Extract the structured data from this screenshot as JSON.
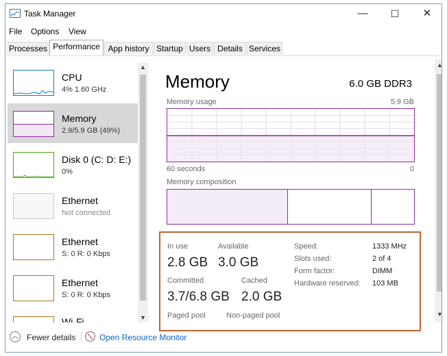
{
  "window": {
    "title": "Task Manager",
    "min": "—",
    "max": "☐",
    "close": "✕"
  },
  "menu": [
    "File",
    "Options",
    "View"
  ],
  "tabs": [
    "Processes",
    "Performance",
    "App history",
    "Startup",
    "Users",
    "Details",
    "Services"
  ],
  "active_tab": "Performance",
  "sidebar": {
    "items": [
      {
        "name": "CPU",
        "sub": "4% 1.60 GHz",
        "icon": "cpu-graph"
      },
      {
        "name": "Memory",
        "sub": "2.9/5.9 GB (49%)",
        "icon": "memory-graph"
      },
      {
        "name": "Disk 0 (C: D: E:)",
        "sub": "0%",
        "icon": "disk-graph"
      },
      {
        "name": "Ethernet",
        "sub": "Not connected",
        "icon": "ethernet-graph"
      },
      {
        "name": "Ethernet",
        "sub": "S: 0 R: 0 Kbps",
        "icon": "ethernet-graph"
      },
      {
        "name": "Ethernet",
        "sub": "S: 0 R: 0 Kbps",
        "icon": "ethernet-graph"
      },
      {
        "name": "Wi-Fi",
        "sub": "",
        "icon": "wifi-graph"
      }
    ],
    "selected_index": 1
  },
  "detail": {
    "title": "Memory",
    "spec": "6.0 GB DDR3",
    "usage_label": "Memory usage",
    "usage_max": "5.9 GB",
    "time_left": "60 seconds",
    "time_right": "0",
    "composition_label": "Memory composition",
    "usage_fraction": 0.49
  },
  "stats": {
    "in_use_label": "In use",
    "in_use": "2.8 GB",
    "available_label": "Available",
    "available": "3.0 GB",
    "committed_label": "Committed",
    "committed": "3.7/6.8 GB",
    "cached_label": "Cached",
    "cached": "2.0 GB",
    "paged_label": "Paged pool",
    "nonpaged_label": "Non-paged pool",
    "speed_label": "Speed:",
    "speed": "1333 MHz",
    "slots_label": "Slots used:",
    "slots": "2 of 4",
    "form_label": "Form factor:",
    "form": "DIMM",
    "reserved_label": "Hardware reserved:",
    "reserved": "103 MB"
  },
  "footer": {
    "fewer": "Fewer details",
    "monitor": "Open Resource Monitor"
  },
  "colors": {
    "memory": "#8c2d9c",
    "cpu": "#117dbb",
    "disk": "#4da60c",
    "ethernet": "#a7751c",
    "highlight": "#c4612a",
    "link": "#0066cc"
  }
}
